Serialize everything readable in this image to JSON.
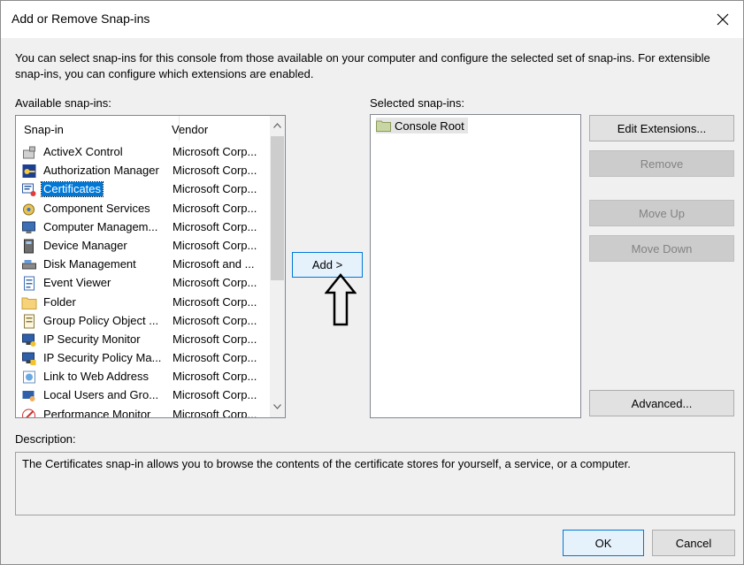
{
  "window": {
    "title": "Add or Remove Snap-ins"
  },
  "intro_text": "You can select snap-ins for this console from those available on your computer and configure the selected set of snap-ins. For extensible snap-ins, you can configure which extensions are enabled.",
  "available": {
    "label": "Available snap-ins:",
    "columns": [
      "Snap-in",
      "Vendor"
    ],
    "items": [
      {
        "name": "ActiveX Control",
        "vendor": "Microsoft Corp...",
        "icon": "activex-icon"
      },
      {
        "name": "Authorization Manager",
        "vendor": "Microsoft Corp...",
        "icon": "authorization-manager-icon"
      },
      {
        "name": "Certificates",
        "vendor": "Microsoft Corp...",
        "icon": "certificates-icon",
        "selected": true
      },
      {
        "name": "Component Services",
        "vendor": "Microsoft Corp...",
        "icon": "component-services-icon"
      },
      {
        "name": "Computer Managem...",
        "vendor": "Microsoft Corp...",
        "icon": "computer-management-icon"
      },
      {
        "name": "Device Manager",
        "vendor": "Microsoft Corp...",
        "icon": "device-manager-icon"
      },
      {
        "name": "Disk Management",
        "vendor": "Microsoft and ...",
        "icon": "disk-management-icon"
      },
      {
        "name": "Event Viewer",
        "vendor": "Microsoft Corp...",
        "icon": "event-viewer-icon"
      },
      {
        "name": "Folder",
        "vendor": "Microsoft Corp...",
        "icon": "folder-icon"
      },
      {
        "name": "Group Policy Object ...",
        "vendor": "Microsoft Corp...",
        "icon": "group-policy-icon"
      },
      {
        "name": "IP Security Monitor",
        "vendor": "Microsoft Corp...",
        "icon": "ip-security-monitor-icon"
      },
      {
        "name": "IP Security Policy Ma...",
        "vendor": "Microsoft Corp...",
        "icon": "ip-security-policy-icon"
      },
      {
        "name": "Link to Web Address",
        "vendor": "Microsoft Corp...",
        "icon": "web-link-icon"
      },
      {
        "name": "Local Users and Gro...",
        "vendor": "Microsoft Corp...",
        "icon": "local-users-icon"
      },
      {
        "name": "Performance Monitor",
        "vendor": "Microsoft Corp...",
        "icon": "performance-monitor-icon"
      }
    ]
  },
  "add_button": "Add >",
  "selected": {
    "label": "Selected snap-ins:",
    "items": [
      {
        "name": "Console Root",
        "icon": "folder-icon"
      }
    ]
  },
  "buttons": {
    "edit_extensions": "Edit Extensions...",
    "remove": "Remove",
    "move_up": "Move Up",
    "move_down": "Move Down",
    "advanced": "Advanced...",
    "ok": "OK",
    "cancel": "Cancel"
  },
  "description": {
    "label": "Description:",
    "text": "The Certificates snap-in allows you to browse the contents of the certificate stores for yourself, a service, or a computer."
  },
  "colors": {
    "selection": "#0078d7",
    "dialog_bg": "#f0f0f0"
  }
}
